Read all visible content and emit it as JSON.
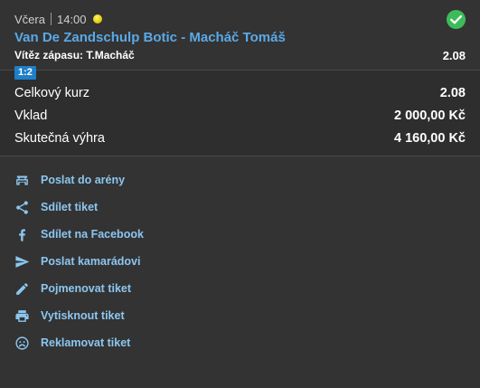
{
  "event": {
    "day": "Včera",
    "time": "14:00",
    "title": "Van De Zandschulp Botic - Macháč Tomáš",
    "bet_label": "Vítěz zápasu:",
    "bet_pick": "T.Macháč",
    "odds": "2.08",
    "score": "1:2",
    "status_icon": "check-circle-icon",
    "sport_icon": "tennis-ball-icon"
  },
  "summary": {
    "rows": [
      {
        "label": "Celkový kurz",
        "value": "2.08"
      },
      {
        "label": "Vklad",
        "value": "2 000,00 Kč"
      },
      {
        "label": "Skutečná výhra",
        "value": "4 160,00 Kč"
      }
    ]
  },
  "actions": [
    {
      "label": "Poslat do arény",
      "icon": "arena-icon"
    },
    {
      "label": "Sdílet tiket",
      "icon": "share-icon"
    },
    {
      "label": "Sdílet na Facebook",
      "icon": "facebook-icon"
    },
    {
      "label": "Poslat kamarádovi",
      "icon": "send-icon"
    },
    {
      "label": "Pojmenovat tiket",
      "icon": "pencil-icon"
    },
    {
      "label": "Vytisknout tiket",
      "icon": "print-icon"
    },
    {
      "label": "Reklamovat tiket",
      "icon": "sad-face-icon"
    }
  ],
  "colors": {
    "background": "#333333",
    "link": "#5aa9e6",
    "action_text": "#8cc6f0",
    "success": "#3dbb5a",
    "badge": "#1f7fc9"
  }
}
